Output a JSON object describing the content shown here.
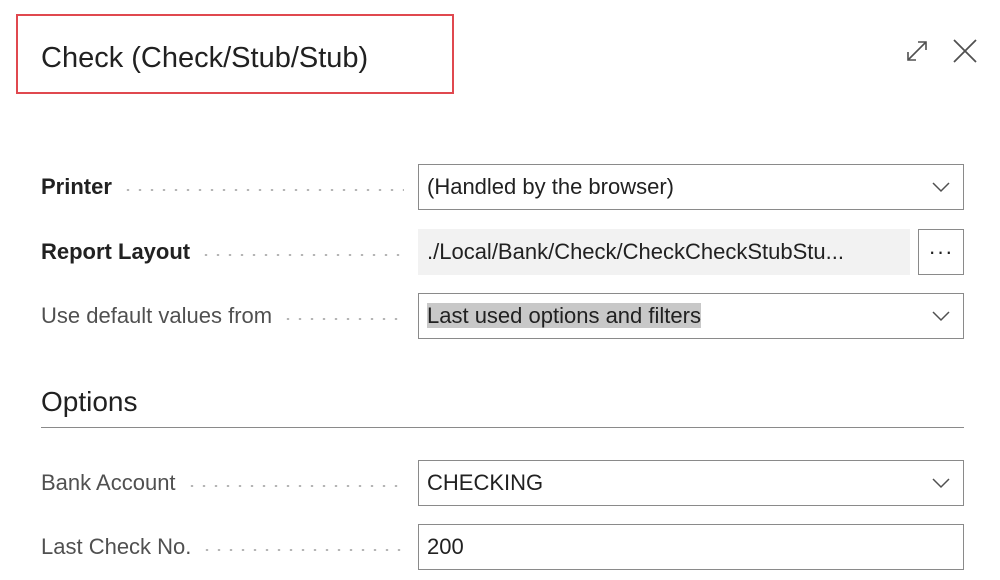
{
  "dialog": {
    "title": "Check (Check/Stub/Stub)",
    "expand_icon": "expand-icon",
    "close_icon": "close-icon"
  },
  "fields": {
    "printer": {
      "label": "Printer",
      "value": "(Handled by the browser)"
    },
    "report_layout": {
      "label": "Report Layout",
      "value": "./Local/Bank/Check/CheckCheckStubStu...",
      "more_label": "···"
    },
    "default_values": {
      "label": "Use default values from",
      "value": "Last used options and filters"
    }
  },
  "options": {
    "section_title": "Options",
    "bank_account": {
      "label": "Bank Account",
      "value": "CHECKING"
    },
    "last_check_no": {
      "label": "Last Check No.",
      "value": "200"
    }
  },
  "colors": {
    "highlight_border": "#e0484f",
    "field_border": "#8a8a8a",
    "readonly_bg": "#f2f2f2",
    "selection_bg": "#c8c8c8"
  }
}
